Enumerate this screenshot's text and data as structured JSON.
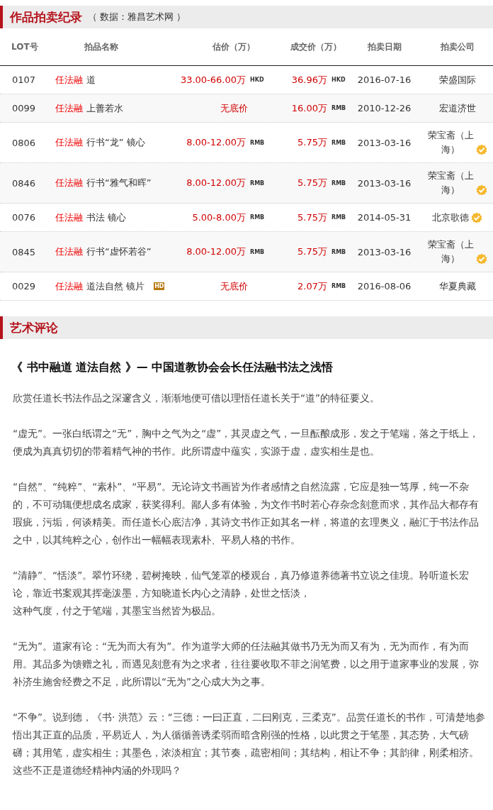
{
  "auction_section": {
    "title": "作品拍卖纪录",
    "source": "（ 数据：雅昌艺术网 ）"
  },
  "table": {
    "columns": [
      "LOT号",
      "拍品名称",
      "估价（万）",
      "成交价（万）",
      "拍卖日期",
      "拍卖公司"
    ],
    "rows": [
      {
        "lot": "0107",
        "artist": "任法融",
        "title": "道",
        "estimate": "33.00-66.00万",
        "estimate_currency": "HKD",
        "price": "36.96万",
        "price_currency": "HKD",
        "date": "2016-07-16",
        "company": "荣盛国际",
        "verified": false
      },
      {
        "lot": "0099",
        "artist": "任法融",
        "title": "上善若水",
        "estimate": "无底价",
        "price": "16.00万",
        "price_currency": "RMB",
        "date": "2010-12-26",
        "company": "宏道济世",
        "verified": false
      },
      {
        "lot": "0806",
        "artist": "任法融",
        "title": "行书“龙” 镜心",
        "estimate": "8.00-12.00万",
        "estimate_currency": "RMB",
        "price": "5.75万",
        "price_currency": "RMB",
        "date": "2013-03-16",
        "company": "荣宝斋（上海）",
        "verified": true
      },
      {
        "lot": "0846",
        "artist": "任法融",
        "title": "行书“雅气和晖”",
        "estimate": "8.00-12.00万",
        "estimate_currency": "RMB",
        "price": "5.75万",
        "price_currency": "RMB",
        "date": "2013-03-16",
        "company": "荣宝斋（上海）",
        "verified": true
      },
      {
        "lot": "0076",
        "artist": "任法融",
        "title": "书法 镜心",
        "estimate": "5.00-8.00万",
        "estimate_currency": "RMB",
        "price": "5.75万",
        "price_currency": "RMB",
        "date": "2014-05-31",
        "company": "北京歌德",
        "verified": true
      },
      {
        "lot": "0845",
        "artist": "任法融",
        "title": "行书“虚怀若谷”",
        "estimate": "8.00-12.00万",
        "estimate_currency": "RMB",
        "price": "5.75万",
        "price_currency": "RMB",
        "date": "2013-03-16",
        "company": "荣宝斋（上海）",
        "verified": true
      },
      {
        "lot": "0029",
        "artist": "任法融",
        "title": "道法自然 镜片",
        "badge": "HD",
        "estimate": "无底价",
        "price": "2.07万",
        "price_currency": "RMB",
        "date": "2016-08-06",
        "company": "华夏典藏",
        "verified": false
      }
    ]
  },
  "review_section": {
    "title": "艺术评论",
    "article_title": "《 书中融道  道法自然  》—  中国道教协会会长任法融书法之浅悟",
    "paragraphs": [
      "欣赏任道长书法作品之深邃含义，渐渐地便可借以理悟任道长关于“道”的特征要义。",
      "“虚无”。一张白纸谓之“无”，胸中之气为之“虚”，其灵虚之气，一旦酝酿成形，发之于笔端，落之于纸上，便成为真真切切的带着精气神的书作。此所谓虚中蕴实，实源于虚，虚实相生是也。",
      "“自然”、“纯粹”、“素朴”、“平易”。无论诗文书画皆为作者感情之自然流露，它应是独一笃厚，纯一不杂的，不可动辄便想成名成家，获奖得利。鄙人多有体验，为文作书时若心存杂念刻意而求，其作品大都存有瑕疵，污垢，何谈精美。而任道长心底洁净，其诗文书作正如其名一样，将道的玄理奥义，融汇于书法作品之中，以其纯粹之心，创作出一幅幅表现素朴、平易人格的书作。",
      [
        "“清静”、“恬淡”。翠竹环绕，碧树掩映，仙气笼罩的楼观台，真乃修道养德著书立说之佳境。聆听道长宏论，靠近书案观其挥毫泼墨，方知晓道长内心之清静，处世之恬淡，",
        "这种气度，付之于笔端，其墨宝当然皆为极品。"
      ],
      "“无为”。道家有论：“无为而大有为”。作为道学大师的任法融其做书乃无为而又有为，无为而作，有为而用。其品多为馈赠之礼，而遇见刻意有为之求者，往往要收取不菲之润笔费，以之用于道家事业的发展，弥补济生施舍经费之不足，此所谓以“无为”之心成大为之事。",
      "“不争”。说到德，《书· 洪范》云：“三德：一曰正直，二曰刚克，三柔克”。品赏任道长的书作，可清楚地参悟出其正直的品质，平易近人，为人循循善诱柔弱而暗含刚强的性格，以此贯之于笔墨，其态势，大气磅礴；其用笔，虚实相生；其墨色，浓淡相宜；其节奏，疏密相间；其结构，相让不争；其韵律，刚柔相济。这些不正是道德经精神内涵的外现吗？"
    ]
  }
}
